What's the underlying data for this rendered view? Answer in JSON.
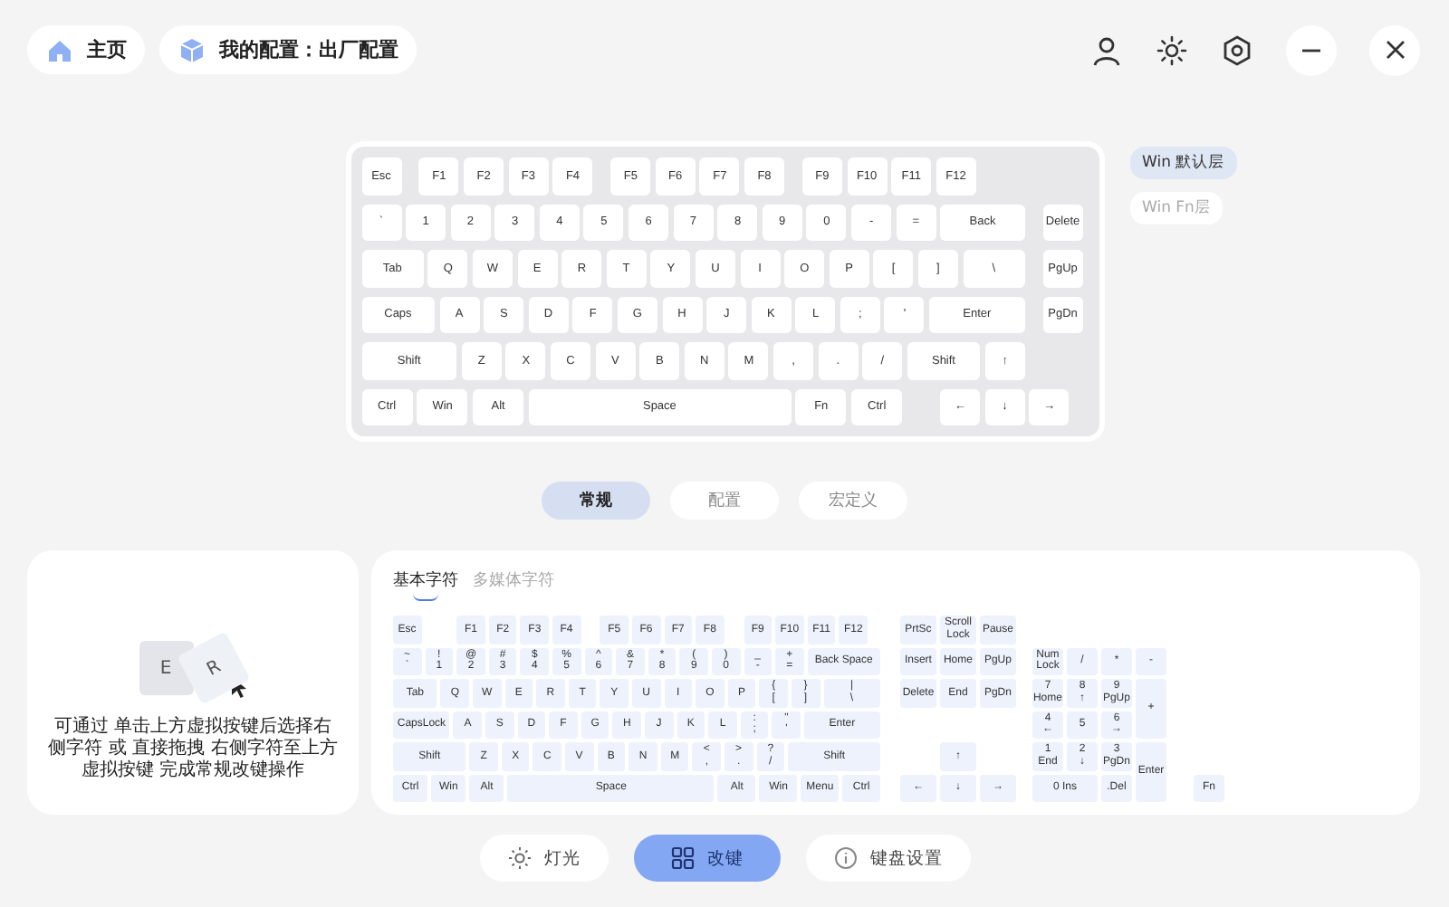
{
  "topbar": {
    "home": "主页",
    "config": "我的配置：出厂配置"
  },
  "keyboard": {
    "rows": [
      [
        "Esc",
        "F1",
        "F2",
        "F3",
        "F4",
        "F5",
        "F6",
        "F7",
        "F8",
        "F9",
        "F10",
        "F11",
        "F12"
      ],
      [
        "`",
        "1",
        "2",
        "3",
        "4",
        "5",
        "6",
        "7",
        "8",
        "9",
        "0",
        "-",
        "=",
        "Back"
      ],
      [
        "Tab",
        "Q",
        "W",
        "E",
        "R",
        "T",
        "Y",
        "U",
        "I",
        "O",
        "P",
        "[",
        "]",
        "\\"
      ],
      [
        "Caps",
        "A",
        "S",
        "D",
        "F",
        "G",
        "H",
        "J",
        "K",
        "L",
        ";",
        "'",
        "Enter"
      ],
      [
        "Shift",
        "Z",
        "X",
        "C",
        "V",
        "B",
        "N",
        "M",
        ",",
        ".",
        "/",
        "Shift",
        "↑"
      ],
      [
        "Ctrl",
        "Win",
        "Alt",
        "Space",
        "Fn",
        "Ctrl",
        "←",
        "↓",
        "→"
      ]
    ],
    "side_keys": [
      "Delete",
      "PgUp",
      "PgDn"
    ]
  },
  "layers": [
    {
      "label": "Win 默认层",
      "selected": true
    },
    {
      "label": "Win Fn层",
      "selected": false
    }
  ],
  "modes": [
    {
      "label": "常规",
      "selected": true
    },
    {
      "label": "配置",
      "selected": false
    },
    {
      "label": "宏定义",
      "selected": false
    }
  ],
  "hint": {
    "keys": [
      "E",
      "R"
    ],
    "text": "可通过 单击上方虚拟按键后选择右侧字符 或 直接拖拽 右侧字符至上方虚拟按键 完成常规改键操作"
  },
  "charset_tabs": [
    {
      "label": "基本字符",
      "selected": true
    },
    {
      "label": "多媒体字符",
      "selected": false
    }
  ],
  "charset": {
    "main": [
      [
        "Esc",
        "F1",
        "F2",
        "F3",
        "F4",
        "F5",
        "F6",
        "F7",
        "F8",
        "F9",
        "F10",
        "F11",
        "F12"
      ],
      [
        {
          "upper": "~",
          "label": "`"
        },
        {
          "upper": "!",
          "label": "1"
        },
        {
          "upper": "@",
          "label": "2"
        },
        {
          "upper": "#",
          "label": "3"
        },
        {
          "upper": "$",
          "label": "4"
        },
        {
          "upper": "%",
          "label": "5"
        },
        {
          "upper": "^",
          "label": "6"
        },
        {
          "upper": "&",
          "label": "7"
        },
        {
          "upper": "*",
          "label": "8"
        },
        {
          "upper": "(",
          "label": "9"
        },
        {
          "upper": ")",
          "label": "0"
        },
        {
          "upper": "_",
          "label": "-"
        },
        {
          "upper": "+",
          "label": "="
        },
        "Back Space"
      ],
      [
        "Tab",
        "Q",
        "W",
        "E",
        "R",
        "T",
        "Y",
        "U",
        "I",
        "O",
        "P",
        {
          "upper": "{",
          "label": "["
        },
        {
          "upper": "}",
          "label": "]"
        },
        {
          "upper": "|",
          "label": "\\"
        }
      ],
      [
        "CapsLock",
        "A",
        "S",
        "D",
        "F",
        "G",
        "H",
        "J",
        "K",
        "L",
        {
          "upper": ":",
          "label": ";"
        },
        {
          "upper": "\"",
          "label": "'"
        },
        "Enter"
      ],
      [
        "Shift",
        "Z",
        "X",
        "C",
        "V",
        "B",
        "N",
        "M",
        {
          "upper": "<",
          "label": ","
        },
        {
          "upper": ">",
          "label": "."
        },
        {
          "upper": "?",
          "label": "/"
        },
        "Shift"
      ],
      [
        "Ctrl",
        "Win",
        "Alt",
        "Space",
        "Alt",
        "Win",
        "Menu",
        "Ctrl"
      ]
    ],
    "nav": {
      "top": [
        [
          "PrtSc",
          "Scroll Lock",
          "Pause"
        ],
        [
          "Insert",
          "Home",
          "PgUp"
        ],
        [
          "Delete",
          "End",
          "PgDn"
        ]
      ],
      "arrows": [
        [
          "↑"
        ],
        [
          "←",
          "↓",
          "→"
        ]
      ]
    },
    "numpad": [
      "Num Lock",
      "/",
      "*",
      "-",
      {
        "upper": "7",
        "label": "Home"
      },
      {
        "upper": "8",
        "label": "↑"
      },
      {
        "upper": "9",
        "label": "PgUp"
      },
      "+",
      {
        "upper": "4",
        "label": "←"
      },
      "5",
      {
        "upper": "6",
        "label": "→"
      },
      {
        "upper": "1",
        "label": "End"
      },
      {
        "upper": "2",
        "label": "↓"
      },
      {
        "upper": "3",
        "label": "PgDn"
      },
      "Enter",
      "0 Ins",
      ".Del"
    ],
    "extra": [
      "Fn"
    ]
  },
  "nav_tabs": [
    {
      "label": "灯光",
      "selected": false
    },
    {
      "label": "改键",
      "selected": true
    },
    {
      "label": "键盘设置",
      "selected": false
    }
  ]
}
